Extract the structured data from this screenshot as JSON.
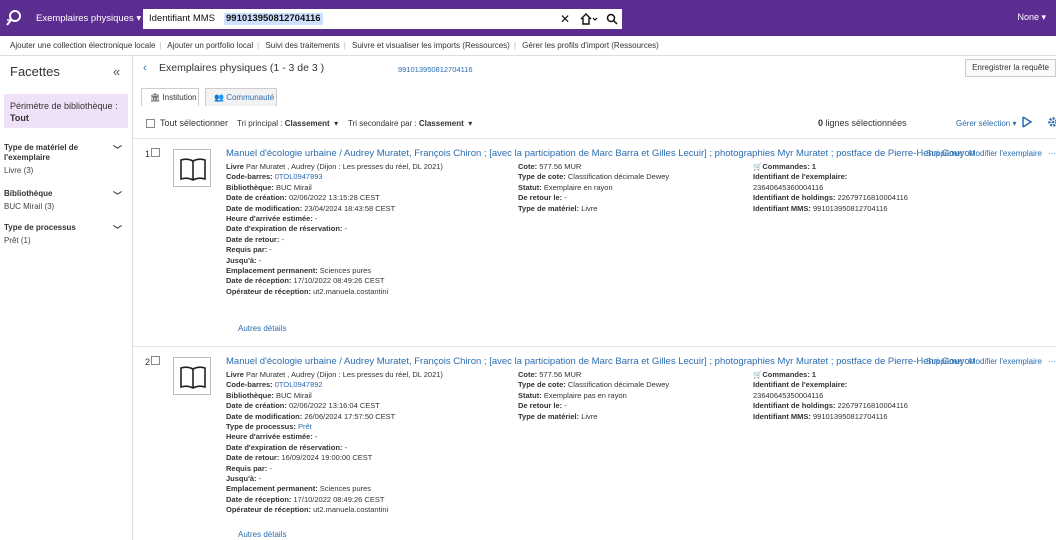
{
  "topbar": {
    "scope": "Exemplaires physiques ▾",
    "field": "Identifiant MMS ▾",
    "query": "991013950812704116",
    "clear": "✕",
    "home": "🏠▾",
    "search": "🔍",
    "user": "None  ▾"
  },
  "links": [
    "Ajouter une collection électronique locale",
    "Ajouter un portfolio local",
    "Suivi des traitements",
    "Suivre et visualiser les imports (Ressources)",
    "Gérer les profils d'import (Ressources)"
  ],
  "facets": {
    "title": "Facettes",
    "collapse": "«",
    "perimetre_label": "Périmètre de bibliothèque : ",
    "perimetre_value": "Tout",
    "groups": [
      {
        "title": "Type de matériel de l'exemplaire",
        "value": "Livre (3)"
      },
      {
        "title": "Bibliothèque",
        "value": "BUC Mirail (3)"
      },
      {
        "title": "Type de processus",
        "value": "Prêt (1)"
      }
    ]
  },
  "header": {
    "back": "‹",
    "title": "Exemplaires physiques (1 - 3 de 3 )",
    "mms": "991013950812704116",
    "save": "Enregistrer la requête"
  },
  "tabs": [
    "Institution",
    "Communauté"
  ],
  "toolbar": {
    "select_all": "Tout sélectionner",
    "sort1_label": "Tri principal : ",
    "sort1_value": "Classement",
    "sort2_label": "Tri secondaire par : ",
    "sort2_value": "Classement",
    "count_num": "0",
    "count_label": " lignes sélectionnées",
    "manage": "Gérer sélection ▾"
  },
  "records": [
    {
      "num": "1",
      "title": "Manuel d'écologie urbaine / Audrey Muratet, François Chiron ; [avec la participation de Marc Barra et Gilles Lecuir] ; photographies Myr Muratet ; postface de Pierre-Henri Gouyon",
      "actions": [
        "Supprimer",
        "Modifier l'exemplaire",
        "···"
      ],
      "col1": [
        [
          "Livre",
          " Par Muratet , Audrey (Dijon : Les presses du réel, DL 2021)"
        ],
        [
          "Code-barres: ",
          "0TOL0947893"
        ],
        [
          "Bibliothèque: ",
          "BUC Mirail"
        ],
        [
          "Date de création: ",
          "02/06/2022 13:15:28 CEST"
        ],
        [
          "Date de modification: ",
          "23/04/2024 18:43:58 CEST"
        ],
        [
          "Heure d'arrivée estimée: ",
          "-"
        ],
        [
          "Date d'expiration de réservation: ",
          "-"
        ],
        [
          "Date de retour: ",
          "-"
        ],
        [
          "Requis par: ",
          "-"
        ],
        [
          "Jusqu'à: ",
          "-"
        ],
        [
          "Emplacement permanent: ",
          "Sciences pures"
        ],
        [
          "Date de réception: ",
          "17/10/2022 08:49:26 CEST"
        ],
        [
          "Opérateur de réception: ",
          "ut2.manuela.costantini"
        ]
      ],
      "col2": [
        [
          "Cote: ",
          "577.56 MUR"
        ],
        [
          "Type de cote: ",
          "Classification décimale Dewey"
        ],
        [
          "Statut: ",
          "Exemplaire en rayon"
        ],
        [
          "De retour le: ",
          "-"
        ],
        [
          "Type de matériel: ",
          "Livre"
        ]
      ],
      "col3": {
        "commandes": "Commandes: 1",
        "id_ex_label": "Identifiant de l'exemplaire:",
        "id_ex": "23640645360004116",
        "holdings_label": "Identifiant de holdings: ",
        "holdings": "22679716810004116",
        "mms_label": "Identifiant MMS: ",
        "mms": "991013950812704116"
      },
      "details": "Autres détails"
    },
    {
      "num": "2",
      "title": "Manuel d'écologie urbaine / Audrey Muratet, François Chiron ; [avec la participation de Marc Barra et Gilles Lecuir] ; photographies Myr Muratet ; postface de Pierre-Henri Gouyon",
      "actions": [
        "Supprimer",
        "Modifier l'exemplaire",
        "···"
      ],
      "col1": [
        [
          "Livre",
          " Par Muratet , Audrey (Dijon : Les presses du réel, DL 2021)"
        ],
        [
          "Code-barres: ",
          "0TOL0947892"
        ],
        [
          "Bibliothèque: ",
          "BUC Mirail"
        ],
        [
          "Date de création: ",
          "02/06/2022 13:16:04 CEST"
        ],
        [
          "Date de modification: ",
          "26/06/2024 17:57:50 CEST"
        ],
        [
          "Type de processus: ",
          "Prêt"
        ],
        [
          "Heure d'arrivée estimée: ",
          "-"
        ],
        [
          "Date d'expiration de réservation: ",
          "-"
        ],
        [
          "Date de retour: ",
          "16/09/2024 19:00:00 CEST"
        ],
        [
          "Requis par: ",
          "-"
        ],
        [
          "Jusqu'à: ",
          "-"
        ],
        [
          "Emplacement permanent: ",
          "Sciences pures"
        ],
        [
          "Date de réception: ",
          "17/10/2022 08:49:26 CEST"
        ],
        [
          "Opérateur de réception: ",
          "ut2.manuela.costantini"
        ]
      ],
      "col2": [
        [
          "Cote: ",
          "577.56 MUR"
        ],
        [
          "Type de cote: ",
          "Classification décimale Dewey"
        ],
        [
          "Statut: ",
          "Exemplaire pas en rayon"
        ],
        [
          "De retour le: ",
          "-"
        ],
        [
          "Type de matériel: ",
          "Livre"
        ]
      ],
      "col3": {
        "commandes": "Commandes: 1",
        "id_ex_label": "Identifiant de l'exemplaire:",
        "id_ex": "23640645350004116",
        "holdings_label": "Identifiant de holdings: ",
        "holdings": "22679716810004116",
        "mms_label": "Identifiant MMS: ",
        "mms": "991013950812704116"
      },
      "details": "Autres détails"
    }
  ],
  "colors": {
    "brand": "#5c2d91",
    "link": "#2b6cb0",
    "perimetre_bg": "#efe1f7"
  }
}
